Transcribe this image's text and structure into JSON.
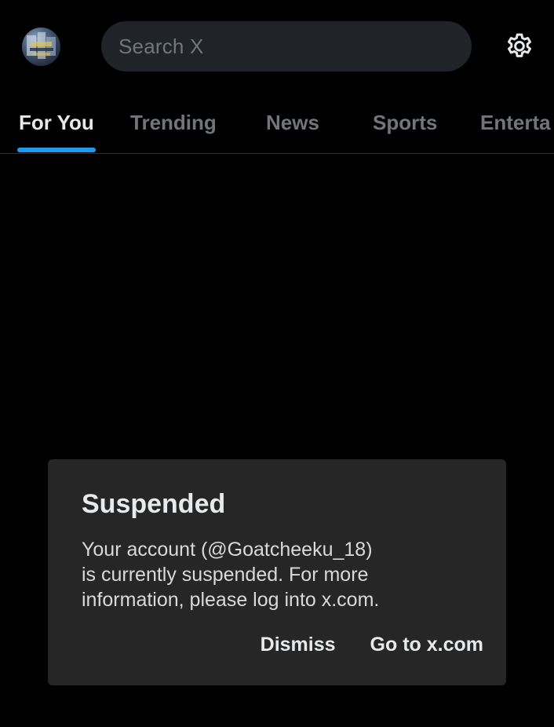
{
  "header": {
    "avatar_icon": "profile-avatar",
    "search_placeholder": "Search X",
    "settings_icon": "gear-icon"
  },
  "tabs": [
    {
      "label": "For You",
      "active": true
    },
    {
      "label": "Trending",
      "active": false
    },
    {
      "label": "News",
      "active": false
    },
    {
      "label": "Sports",
      "active": false
    },
    {
      "label": "Enterta",
      "active": false
    }
  ],
  "dialog": {
    "title": "Suspended",
    "message_lines": [
      "Your account (@Goatcheeku_18)",
      "is currently suspended. For more",
      "information, please log into x.com."
    ],
    "dismiss_label": "Dismiss",
    "goto_label": "Go to x.com"
  },
  "colors": {
    "background": "#000000",
    "accent": "#1d9bf0",
    "dialog_background": "#262626",
    "search_background": "#202327",
    "muted_text": "#71767b"
  }
}
